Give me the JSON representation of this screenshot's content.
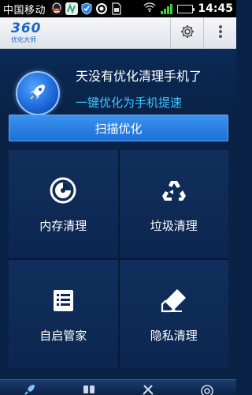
{
  "status_bar": {
    "carrier": "中国移动",
    "time": "14:45",
    "notification_icons": [
      "qq-icon",
      "maps-icon",
      "shield-icon",
      "ring-icon",
      "sim-icon"
    ],
    "battery_level": 1.0
  },
  "app_bar": {
    "logo_number": "360",
    "logo_subtitle": "优化大师",
    "actions": [
      "settings-icon",
      "overflow-menu-icon"
    ]
  },
  "hero": {
    "title": "天没有优化清理手机了",
    "subtitle": "一键优化为手机提速"
  },
  "scan_button": {
    "label": "扫描优化"
  },
  "tiles": [
    {
      "label": "内存清理",
      "icon": "memory-icon"
    },
    {
      "label": "垃圾清理",
      "icon": "recycle-icon"
    },
    {
      "label": "自启管家",
      "icon": "list-icon"
    },
    {
      "label": "隐私清理",
      "icon": "eraser-icon"
    }
  ],
  "bottom_nav": [
    "rocket-icon",
    "apps-icon",
    "tools-icon",
    "radar-icon"
  ],
  "colors": {
    "background": "#0a2245",
    "accent": "#1e6fd6",
    "subtitle": "#3cc6ff",
    "logo": "#1d63c4"
  }
}
